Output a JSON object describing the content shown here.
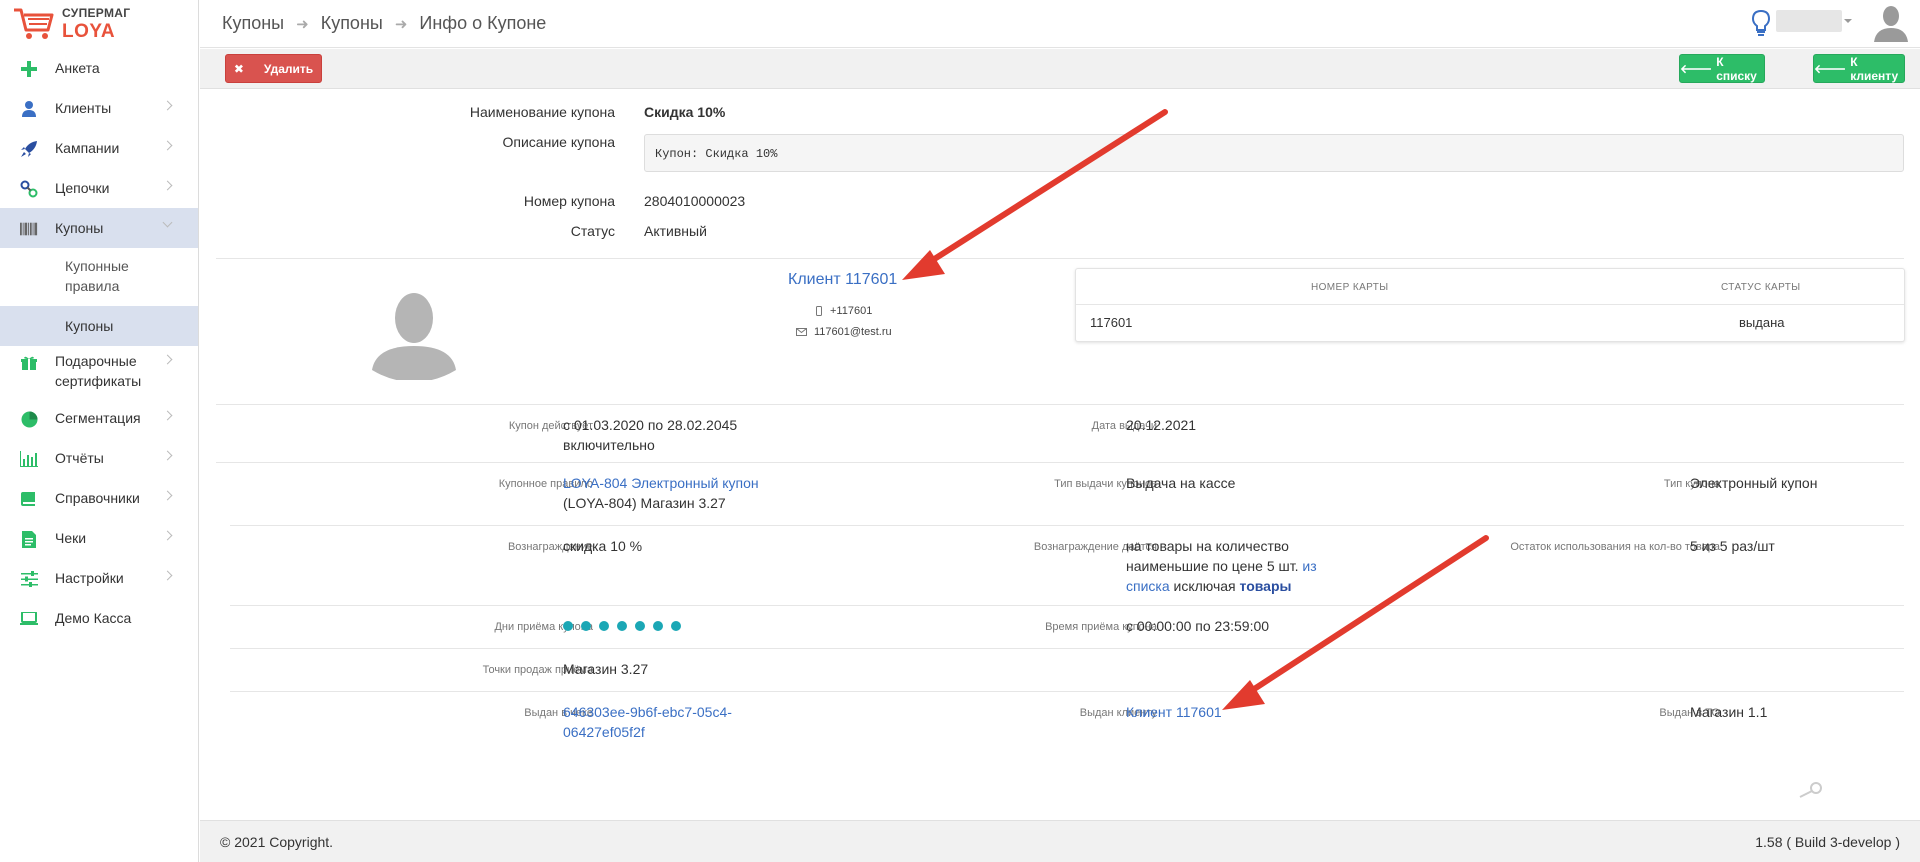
{
  "logo": {
    "line1": "СУПЕРМАГ",
    "line2": "LOYA"
  },
  "sidebar": {
    "items": [
      {
        "label": "Анкета",
        "icon": "plus-icon"
      },
      {
        "label": "Клиенты",
        "icon": "user-icon"
      },
      {
        "label": "Кампании",
        "icon": "rocket-icon"
      },
      {
        "label": "Цепочки",
        "icon": "link-icon"
      },
      {
        "label": "Купоны",
        "icon": "barcode-icon"
      },
      {
        "label": "Подарочные сертификаты",
        "icon": "gift-icon"
      },
      {
        "label": "Сегментация",
        "icon": "pie-chart-icon"
      },
      {
        "label": "Отчёты",
        "icon": "bar-chart-icon"
      },
      {
        "label": "Справочники",
        "icon": "book-icon"
      },
      {
        "label": "Чеки",
        "icon": "receipt-icon"
      },
      {
        "label": "Настройки",
        "icon": "sliders-icon"
      },
      {
        "label": "Демо Касса",
        "icon": "laptop-icon"
      }
    ],
    "coupons_sub": [
      {
        "label": "Купонные правила"
      },
      {
        "label": "Купоны"
      }
    ]
  },
  "header": {
    "breadcrumb": [
      "Купоны",
      "Купоны",
      "Инфо о Купоне"
    ]
  },
  "toolbar": {
    "delete_label": "Удалить",
    "list_label": "К списку",
    "client_label": "К клиенту"
  },
  "coupon": {
    "name_label": "Наименование купона",
    "name_value": "Скидка 10%",
    "desc_label": "Описание купона",
    "desc_value": "Купон: Скидка 10%",
    "number_label": "Номер купона",
    "number_value": "2804010000023",
    "status_label": "Статус",
    "status_value": "Активный"
  },
  "client": {
    "link": "Клиент 117601",
    "phone": "+117601",
    "email": "117601@test.ru"
  },
  "cards": {
    "headers": [
      "НОМЕР КАРТЫ",
      "СТАТУС КАРТЫ"
    ],
    "rows": [
      {
        "number": "117601",
        "status": "выдана"
      }
    ]
  },
  "details": {
    "valid_label": "Купон действует",
    "valid_value_1": "с 01.03.2020 по 28.02.2045",
    "valid_value_2": "включительно",
    "issue_date_label": "Дата выдачи",
    "issue_date_value": "20.12.2021",
    "rule_label": "Купонное правило",
    "rule_link": "LOYA-804 Электронный купон",
    "rule_extra": "(LOYA-804) Магазин 3.27",
    "issue_type_label": "Тип выдачи купонов",
    "issue_type_value": "Выдача на кассе",
    "coupon_type_label": "Тип купона",
    "coupon_type_value": "Электронный купон",
    "reward_label": "Вознаграждение",
    "reward_value": "скидка 10 %",
    "reward_given_label": "Вознаграждение даётся",
    "reward_given_line1": "на товары на количество",
    "reward_given_line2a": "наименьшие по цене 5 шт.",
    "reward_given_link1": "из",
    "reward_given_link2": "списка",
    "reward_given_mid": "исключая",
    "reward_given_link3": "товары",
    "remain_label": "Остаток использования на кол-во товара",
    "remain_value": "5 из 5 раз/шт",
    "days_label": "Дни приёма купона",
    "days_count": 7,
    "time_label": "Время приёма купона",
    "time_value": "с 00:00:00 по 23:59:00",
    "points_label": "Точки продаж приёма",
    "points_value": "Магазин 3.27",
    "receipt_label": "Выдан в чеке",
    "receipt_line1": "646303ee-9b6f-ebc7-05c4-",
    "receipt_line2": "06427ef05f2f",
    "issued_client_label": "Выдан клиенту",
    "issued_client_link": "Клиент 117601",
    "issued_to_label": "Выдан в ТО",
    "issued_to_value": "Магазин 1.1"
  },
  "footer": {
    "copyright": "© 2021 Copyright.",
    "version": "1.58 ( Build 3-develop )"
  },
  "colors": {
    "accent_red": "#d9534f",
    "accent_green": "#2dbd68",
    "link_blue": "#3a6fc4",
    "dot_teal": "#1ba7b5",
    "arrow_red": "#e23b2e",
    "logo_red": "#e8523b"
  }
}
